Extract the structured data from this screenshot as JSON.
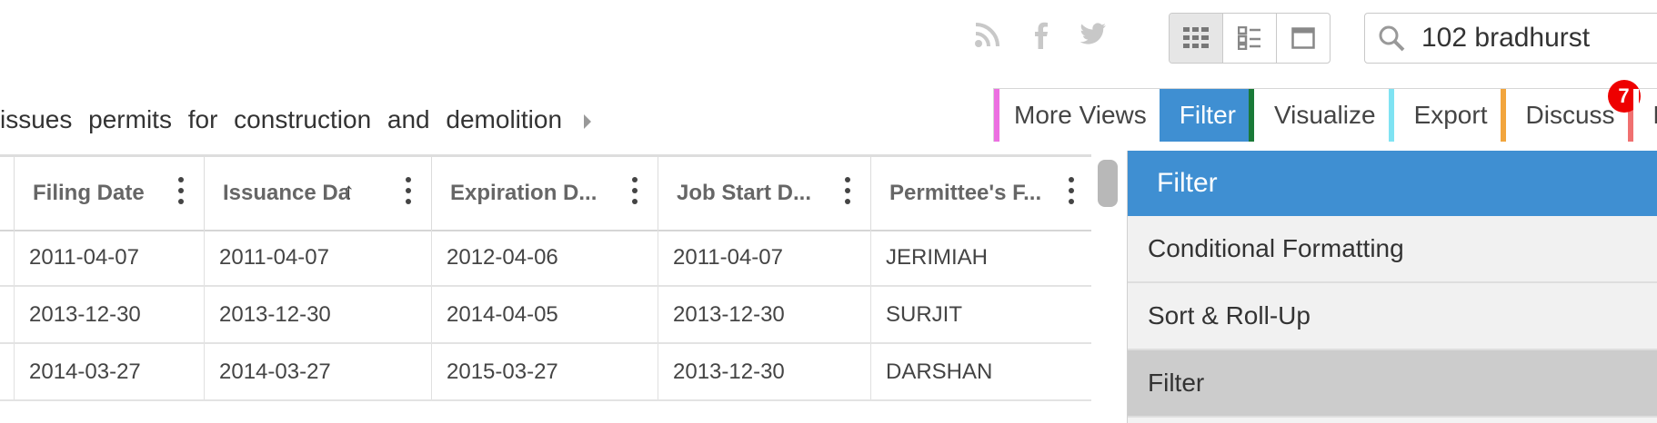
{
  "social": {
    "icons": [
      "rss-icon",
      "facebook-icon",
      "twitter-icon"
    ]
  },
  "view_toggle": {
    "active": "grid-view"
  },
  "search": {
    "value": "102 bradhurst"
  },
  "description": {
    "text": "issues permits for construction and demolition"
  },
  "tabs": [
    {
      "label": "More Views",
      "color": "#ec6fe1"
    },
    {
      "label": "Filter",
      "color": "#1a7a38"
    },
    {
      "label": "Visualize",
      "color": "#7fe3f3"
    },
    {
      "label": "Export",
      "color": "#f2a53d"
    },
    {
      "label": "Discuss",
      "color": "#f07070"
    },
    {
      "label": "Em",
      "color": "#ffffff"
    }
  ],
  "discuss_badge": "7",
  "table": {
    "columns": [
      "Filing Date",
      "Issuance Da",
      "Expiration D...",
      "Job Start D...",
      "Permittee's F..."
    ],
    "rows": [
      [
        "2011-04-07",
        "2011-04-07",
        "2012-04-06",
        "2011-04-07",
        "JERIMIAH"
      ],
      [
        "2013-12-30",
        "2013-12-30",
        "2014-04-05",
        "2013-12-30",
        "SURJIT"
      ],
      [
        "2014-03-27",
        "2014-03-27",
        "2015-03-27",
        "2013-12-30",
        "DARSHAN"
      ]
    ]
  },
  "panel": {
    "title": "Filter",
    "items": [
      {
        "label": "Conditional Formatting",
        "active": false
      },
      {
        "label": "Sort & Roll-Up",
        "active": false
      },
      {
        "label": "Filter",
        "active": true
      }
    ]
  },
  "colors": {
    "accent": "#3f8fd2",
    "badge": "#e00000"
  }
}
